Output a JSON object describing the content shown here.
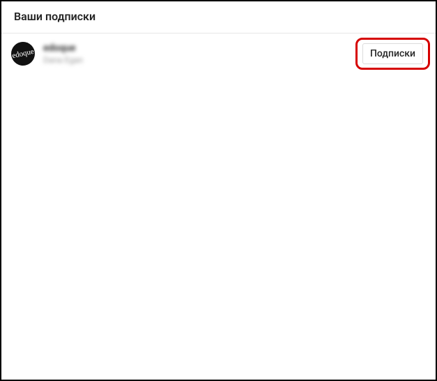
{
  "header": {
    "title": "Ваши подписки"
  },
  "list": [
    {
      "avatar_text": "edoque",
      "username": "edoque",
      "subtext": "Dana Egan",
      "action_label": "Подписки"
    }
  ]
}
